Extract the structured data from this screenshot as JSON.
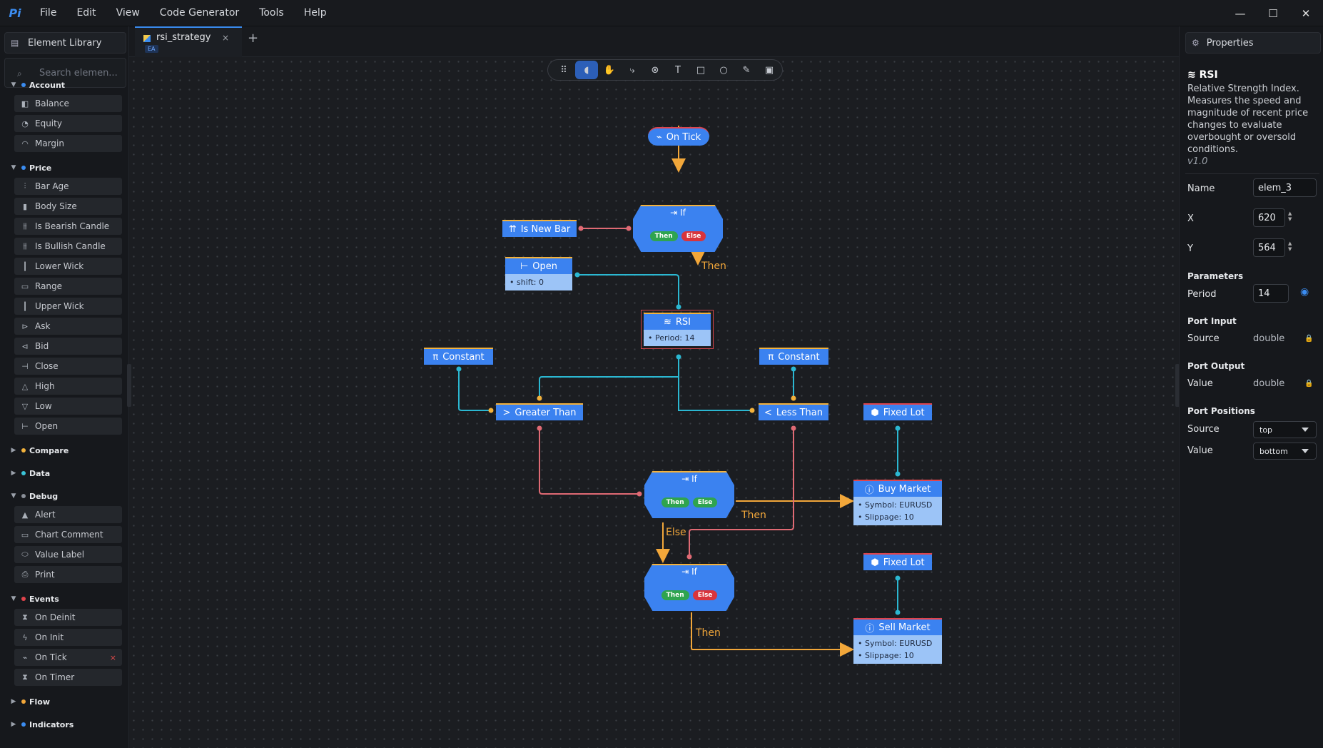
{
  "menubar": {
    "logo": "Pi",
    "items": [
      "File",
      "Edit",
      "View",
      "Code Generator",
      "Tools",
      "Help"
    ],
    "controls": {
      "minimize": "—",
      "maximize": "☐",
      "close": "✕"
    }
  },
  "library": {
    "title": "Element Library",
    "search_placeholder": "Search elemen...",
    "sections": [
      {
        "name": "Account",
        "color": "#3b8cf0",
        "expanded": true,
        "items": [
          "Balance",
          "Equity",
          "Margin"
        ]
      },
      {
        "name": "Price",
        "color": "#3b8cf0",
        "expanded": true,
        "items": [
          "Bar Age",
          "Body Size",
          "Is Bearish Candle",
          "Is Bullish Candle",
          "Lower Wick",
          "Range",
          "Upper Wick",
          "Ask",
          "Bid",
          "Close",
          "High",
          "Low",
          "Open"
        ]
      },
      {
        "name": "Compare",
        "color": "#f2b13c",
        "expanded": false,
        "items": []
      },
      {
        "name": "Data",
        "color": "#3bc4d8",
        "expanded": false,
        "items": []
      },
      {
        "name": "Debug",
        "color": "#8a8f98",
        "expanded": true,
        "items": [
          "Alert",
          "Chart Comment",
          "Value Label",
          "Print"
        ]
      },
      {
        "name": "Events",
        "color": "#e0444c",
        "expanded": true,
        "items": [
          "On Deinit",
          "On Init",
          "On Tick",
          "On Timer"
        ]
      },
      {
        "name": "Flow",
        "color": "#f2a73a",
        "expanded": false,
        "items": []
      },
      {
        "name": "Indicators",
        "color": "#3b8cf0",
        "expanded": false,
        "items": []
      }
    ]
  },
  "tabs": {
    "active": "rsi_strategy",
    "badge": "EA",
    "close": "×",
    "add": "+"
  },
  "toolbar": {
    "tools": [
      "drag-handle",
      "select",
      "pan",
      "connect",
      "link",
      "text",
      "rectangle",
      "ellipse",
      "pen",
      "image"
    ],
    "active_tool": "select"
  },
  "canvas": {
    "nodes": {
      "on_tick": "On Tick",
      "if1": "If",
      "is_new_bar": "Is New Bar",
      "open": "Open",
      "open_param": "shift: 0",
      "rsi": "RSI",
      "rsi_param": "Period: 14",
      "const1": "Constant",
      "const2": "Constant",
      "greater": "Greater Than",
      "less": "Less Than",
      "fixed1": "Fixed Lot",
      "fixed2": "Fixed Lot",
      "if2": "If",
      "if3": "If",
      "buy": "Buy Market",
      "buy_p1": "Symbol: EURUSD",
      "buy_p2": "Slippage: 10",
      "sell": "Sell Market",
      "sell_p1": "Symbol: EURUSD",
      "sell_p2": "Slippage: 10",
      "then": "Then",
      "else": "Else"
    },
    "edge_labels": {
      "l1": "Then",
      "l2": "Then",
      "l3": "Else",
      "l4": "Then"
    }
  },
  "properties": {
    "title": "Properties",
    "element_title": "RSI",
    "description": "Relative Strength Index. Measures the speed and magnitude of recent price changes to evaluate overbought or oversold conditions.",
    "version": "v1.0",
    "name_label": "Name",
    "name_value": "elem_3",
    "x_label": "X",
    "x_value": "620",
    "y_label": "Y",
    "y_value": "564",
    "parameters_label": "Parameters",
    "period_label": "Period",
    "period_value": "14",
    "port_input_label": "Port Input",
    "source_label": "Source",
    "source_type": "double",
    "port_output_label": "Port Output",
    "value_label": "Value",
    "value_type": "double",
    "port_positions_label": "Port Positions",
    "pos_source_label": "Source",
    "pos_source_value": "top",
    "pos_value_label": "Value",
    "pos_value_value": "bottom"
  }
}
